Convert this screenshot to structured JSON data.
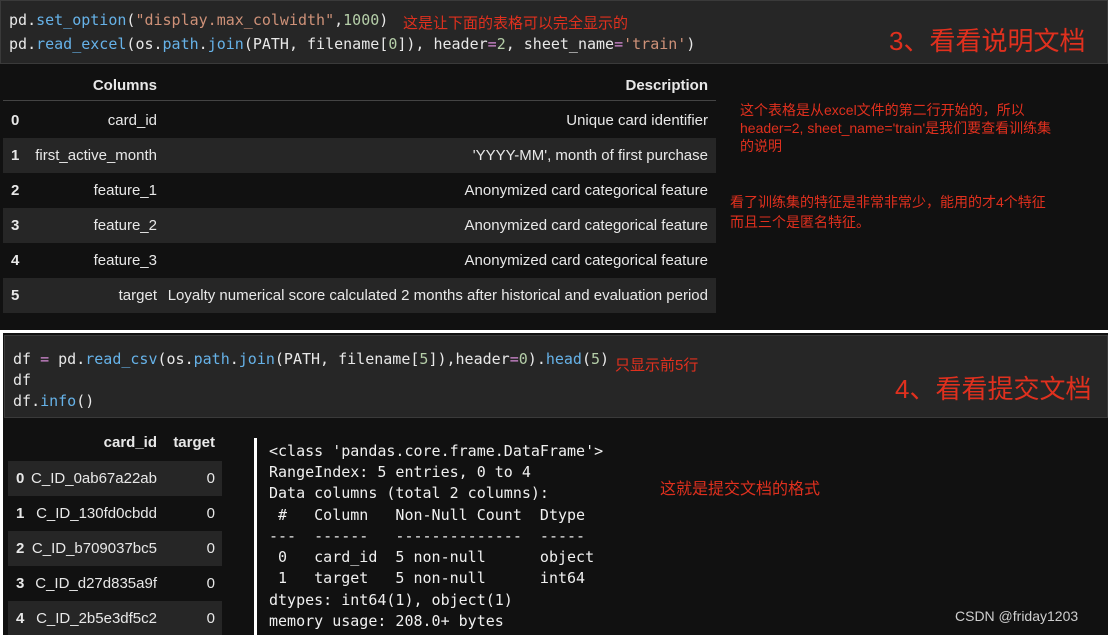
{
  "cell1": {
    "line1_parts": [
      "pd",
      ".",
      "set_option",
      "(",
      "\"display.max_colwidth\"",
      ",",
      "1000",
      ")"
    ],
    "line2_parts": [
      "pd",
      ".",
      "read_excel",
      "(",
      "os",
      ".",
      "path",
      ".",
      "join",
      "(PATH, filename[",
      "0",
      "]), header",
      "=",
      "2",
      ", sheet_name",
      "=",
      "'train'",
      ")"
    ],
    "note": "这是让下面的表格可以完全显示的",
    "section_title": "3、看看说明文档"
  },
  "table1": {
    "headers": [
      "Columns",
      "Description"
    ],
    "rows": [
      {
        "index": "0",
        "column": "card_id",
        "description": "Unique card identifier"
      },
      {
        "index": "1",
        "column": "first_active_month",
        "description": "'YYYY-MM', month of first purchase"
      },
      {
        "index": "2",
        "column": "feature_1",
        "description": "Anonymized card categorical feature"
      },
      {
        "index": "3",
        "column": "feature_2",
        "description": "Anonymized card categorical feature"
      },
      {
        "index": "4",
        "column": "feature_3",
        "description": "Anonymized card categorical feature"
      },
      {
        "index": "5",
        "column": "target",
        "description": "Loyalty numerical score calculated 2 months after historical and evaluation period"
      }
    ]
  },
  "annotations": {
    "note1_lines": [
      "这个表格是从excel文件的第二行开始的，所以",
      "header=2, sheet_name='train'是我们要查看训练集",
      "的说明"
    ],
    "note2_lines": [
      "看了训练集的特征是非常非常少，能用的才4个特征",
      "而且三个是匿名特征。"
    ],
    "note3": "这就是提交文档的格式"
  },
  "cell2": {
    "line1_parts": [
      "df ",
      "=",
      " pd",
      ".",
      "read_csv",
      "(",
      "os",
      ".",
      "path",
      ".",
      "join",
      "(PATH, filename[",
      "5",
      "]),header",
      "=",
      "0",
      ")",
      ".",
      "head",
      "(",
      "5",
      ")"
    ],
    "line2": "df",
    "line3_parts": [
      "df",
      ".",
      "info",
      "()"
    ],
    "note": "只显示前5行",
    "section_title": "4、看看提交文档"
  },
  "table2": {
    "headers": [
      "card_id",
      "target"
    ],
    "rows": [
      {
        "index": "0",
        "card_id": "C_ID_0ab67a22ab",
        "target": "0"
      },
      {
        "index": "1",
        "card_id": "C_ID_130fd0cbdd",
        "target": "0"
      },
      {
        "index": "2",
        "card_id": "C_ID_b709037bc5",
        "target": "0"
      },
      {
        "index": "3",
        "card_id": "C_ID_d27d835a9f",
        "target": "0"
      },
      {
        "index": "4",
        "card_id": "C_ID_2b5e3df5c2",
        "target": "0"
      }
    ]
  },
  "info_output": {
    "lines": [
      "<class 'pandas.core.frame.DataFrame'>",
      "RangeIndex: 5 entries, 0 to 4",
      "Data columns (total 2 columns):",
      " #   Column   Non-Null Count  Dtype ",
      "---  ------   --------------  ----- ",
      " 0   card_id  5 non-null      object",
      " 1   target   5 non-null      int64 ",
      "dtypes: int64(1), object(1)",
      "memory usage: 208.0+ bytes"
    ]
  },
  "watermark": "CSDN @friday1203"
}
